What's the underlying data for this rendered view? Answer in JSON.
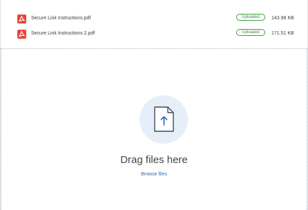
{
  "files": [
    {
      "name": "Secure Link Instructions.pdf",
      "status": "Uploaded",
      "size": "143.98 KB",
      "icon": "pdf-icon"
    },
    {
      "name": "Secure Link Instructions 2.pdf",
      "status": "Uploaded",
      "size": "171.51 KB",
      "icon": "pdf-icon"
    }
  ],
  "dropzone": {
    "title": "Drag files here",
    "browse_label": "Browse files",
    "icon": "file-upload-icon"
  },
  "colors": {
    "pdf_red": "#e3473a",
    "uploaded_green": "#3da03d",
    "link_blue": "#2a6db5",
    "circle_bg": "#e6eef7"
  }
}
